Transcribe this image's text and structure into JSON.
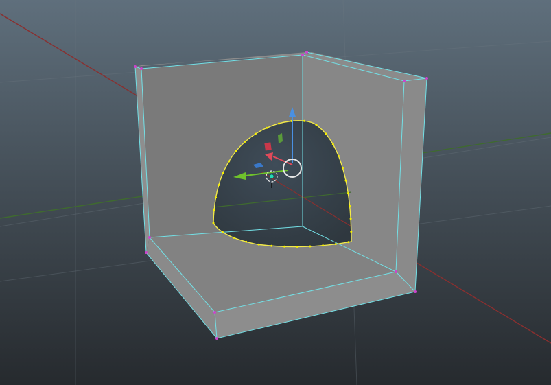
{
  "viewport": {
    "background_top": "#5f6f7c",
    "background_bottom": "#262a2e"
  },
  "colors": {
    "grid_line": "#6d7882",
    "axis_x": "#8a2f2f",
    "axis_z": "#3f6a2f",
    "face_top": "#8b8b8b",
    "face_back": "#7b7b7b",
    "face_side": "#858585",
    "face_floor": "#828282",
    "face_front": "#8d8d8d",
    "wireframe": "#73e0e6",
    "vertex": "#cc44cc",
    "selected_edge": "#f2e94a",
    "selected_vertex": "#f7f000",
    "gizmo_y": "#4a90e2",
    "gizmo_x": "#e04a5a",
    "gizmo_z": "#6fc22c",
    "pivot_ring": "#e6e6e6"
  },
  "scene": {
    "object": "corner-block-with-dome-cutout",
    "selection": "curved-edge-loop",
    "gizmo": "translate-move-manipulator"
  }
}
